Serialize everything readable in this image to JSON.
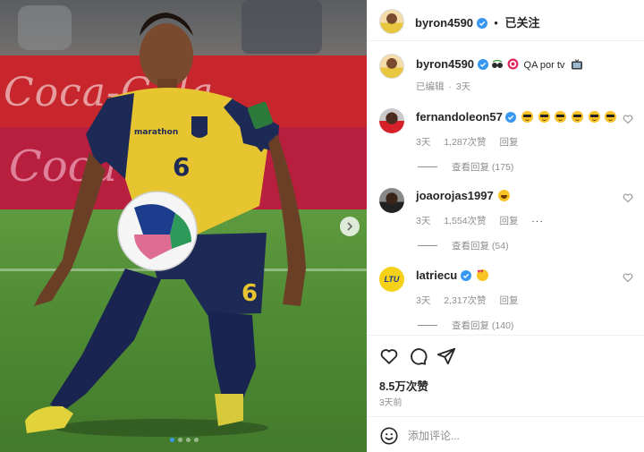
{
  "post": {
    "author": "byron4590",
    "header_separator": "•",
    "follow_status": "已关注",
    "caption": {
      "text": "QA por tv",
      "edited": "已编辑",
      "meta_sep": "·",
      "time": "3天"
    },
    "media": {
      "slide_count": 4,
      "active_slide": 1,
      "board_text_1": "Coca-Cola",
      "board_text_2": "Coca-Cola",
      "jersey_number": "6",
      "shorts_number": "6",
      "sponsor": "marathon"
    },
    "stats": {
      "likes": "8.5万次赞",
      "posted": "3天前"
    },
    "add_comment_placeholder": "添加评论..."
  },
  "comments": [
    {
      "user": "fernandoleon57",
      "emoji_count": 6,
      "time": "3天",
      "likes": "1,287次赞",
      "reply": "回复",
      "view_replies": "查看回复 (175)"
    },
    {
      "user": "joaorojas1997",
      "time": "3天",
      "likes": "1,554次赞",
      "reply": "回复",
      "more": "···",
      "view_replies": "查看回复 (54)"
    },
    {
      "user": "latriecu",
      "avatar_text": "LTU",
      "time": "3天",
      "likes": "2,317次赞",
      "reply": "回复",
      "view_replies": "查看回复 (140)"
    }
  ],
  "colors": {
    "verified": "#3897f0",
    "text_primary": "#262626",
    "text_secondary": "#8e8e8e",
    "border": "#efefef"
  }
}
